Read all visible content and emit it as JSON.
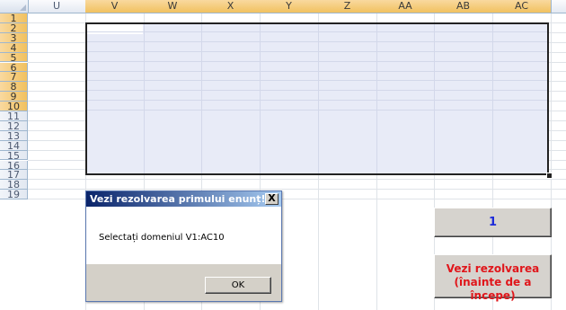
{
  "sheet": {
    "columns": [
      "U",
      "V",
      "W",
      "X",
      "Y",
      "Z",
      "AA",
      "AB",
      "AC"
    ],
    "selected_columns": [
      "V",
      "W",
      "X",
      "Y",
      "Z",
      "AA",
      "AB",
      "AC"
    ],
    "rows": [
      "1",
      "2",
      "3",
      "4",
      "5",
      "6",
      "7",
      "8",
      "9",
      "10",
      "11",
      "12",
      "13",
      "14",
      "15",
      "16",
      "17",
      "18",
      "19"
    ],
    "selected_rows": [
      "1",
      "2",
      "3",
      "4",
      "5",
      "6",
      "7",
      "8",
      "9",
      "10"
    ]
  },
  "dialog": {
    "title": "Vezi rezolvarea primului enunț!",
    "close_label": "X",
    "message": "Selectați domeniul V1:AC10",
    "ok_label": "OK"
  },
  "buttons": {
    "counter_value": "1",
    "solution_line1": "Vezi rezolvarea",
    "solution_line2": "(înainte de a începe)"
  },
  "colors": {
    "selection_fill": "#e8ebf7",
    "header_highlight": "#f1c15f",
    "solution_text": "#e0161b",
    "counter_text": "#1d2bd9"
  }
}
